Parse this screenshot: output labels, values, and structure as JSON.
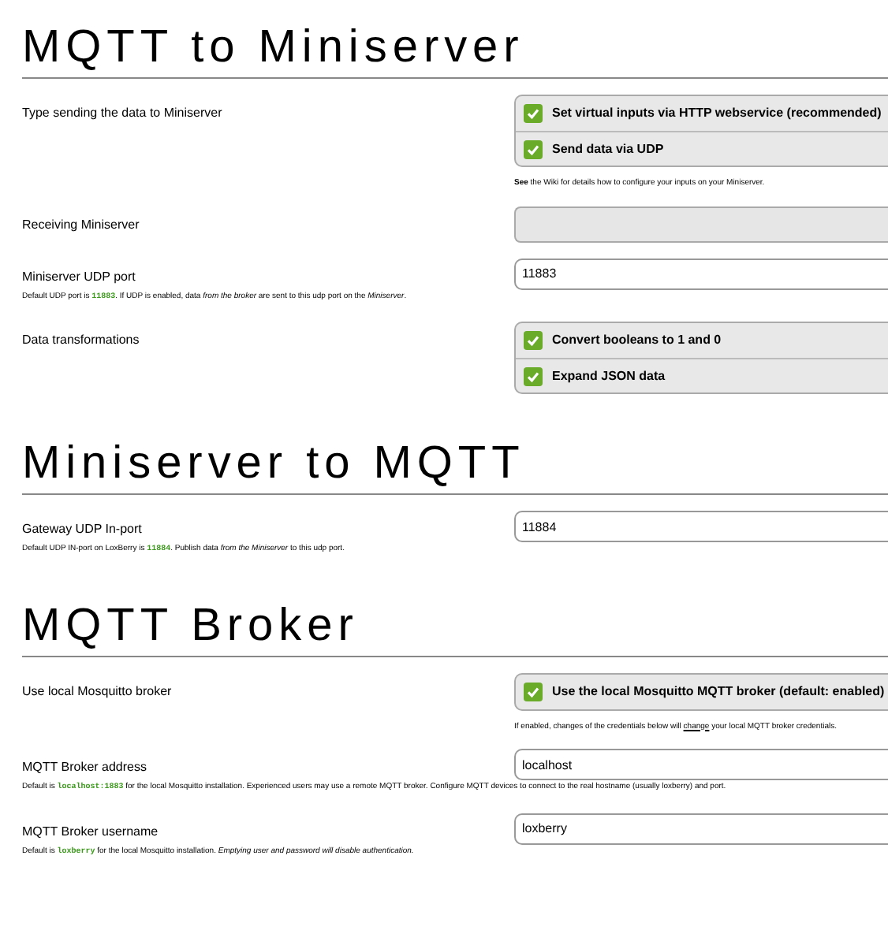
{
  "sections": [
    {
      "title": "MQTT to Miniserver",
      "rows": [
        {
          "label": "Type sending the data to Miniserver",
          "control": {
            "kind": "checkgroup",
            "options": [
              {
                "label": "Set virtual inputs via HTTP webservice (recommended)",
                "checked": true
              },
              {
                "label": "Send data via UDP",
                "checked": true
              }
            ]
          },
          "note": [
            {
              "kind": "text",
              "text": "**See** the Wiki for details how to configure your inputs on your Miniserver."
            }
          ]
        },
        {
          "label": "Receiving Miniserver",
          "control": {
            "kind": "select"
          }
        },
        {
          "label": "Miniserver UDP port",
          "control": {
            "kind": "input",
            "value": "11883"
          },
          "hint": [
            {
              "kind": "text",
              "text": "Default UDP port is "
            },
            {
              "kind": "code",
              "text": "11883"
            },
            {
              "kind": "text",
              "text": ". If UDP is enabled, data *from the broker* are sent to this udp port on the *Miniserver*."
            }
          ]
        },
        {
          "label": "Data transformations",
          "control": {
            "kind": "checkgroup",
            "options": [
              {
                "label": "Convert booleans to 1 and 0",
                "checked": true
              },
              {
                "label": "Expand JSON data",
                "checked": true
              }
            ]
          }
        }
      ]
    },
    {
      "title": "Miniserver to MQTT",
      "rows": [
        {
          "label": "Gateway UDP In-port",
          "control": {
            "kind": "input",
            "value": "11884"
          },
          "hint": [
            {
              "kind": "text",
              "text": "Default UDP IN-port on LoxBerry is "
            },
            {
              "kind": "code",
              "text": "11884"
            },
            {
              "kind": "text",
              "text": ". Publish data *from the Miniserver* to this udp port."
            }
          ]
        }
      ]
    },
    {
      "title": "MQTT Broker",
      "rows": [
        {
          "label": "Use local Mosquitto broker",
          "control": {
            "kind": "checkgroup",
            "options": [
              {
                "label": "Use the local Mosquitto MQTT broker (default: enabled)",
                "checked": true
              }
            ]
          },
          "note": [
            {
              "kind": "text",
              "text": "If enabled, changes of the credentials below will "
            },
            {
              "kind": "underline",
              "text": "change"
            },
            {
              "kind": "text",
              "text": " your local MQTT broker credentials."
            }
          ]
        },
        {
          "label": "MQTT Broker address",
          "control": {
            "kind": "input",
            "value": "localhost"
          },
          "hint": [
            {
              "kind": "text",
              "text": "Default is "
            },
            {
              "kind": "code",
              "text": "localhost:1883"
            },
            {
              "kind": "text",
              "text": " for the local Mosquitto installation. Experienced users may use a remote MQTT broker. Configure MQTT devices to connect to the real hostname (usually loxberry) and port."
            }
          ]
        },
        {
          "label": "MQTT Broker username",
          "control": {
            "kind": "input",
            "value": "loxberry"
          },
          "hint": [
            {
              "kind": "text",
              "text": "Default is "
            },
            {
              "kind": "code",
              "text": "loxberry"
            },
            {
              "kind": "text",
              "text": " for the local Mosquitto installation. *Emptying user and password will disable authentication.*"
            }
          ]
        }
      ]
    }
  ]
}
